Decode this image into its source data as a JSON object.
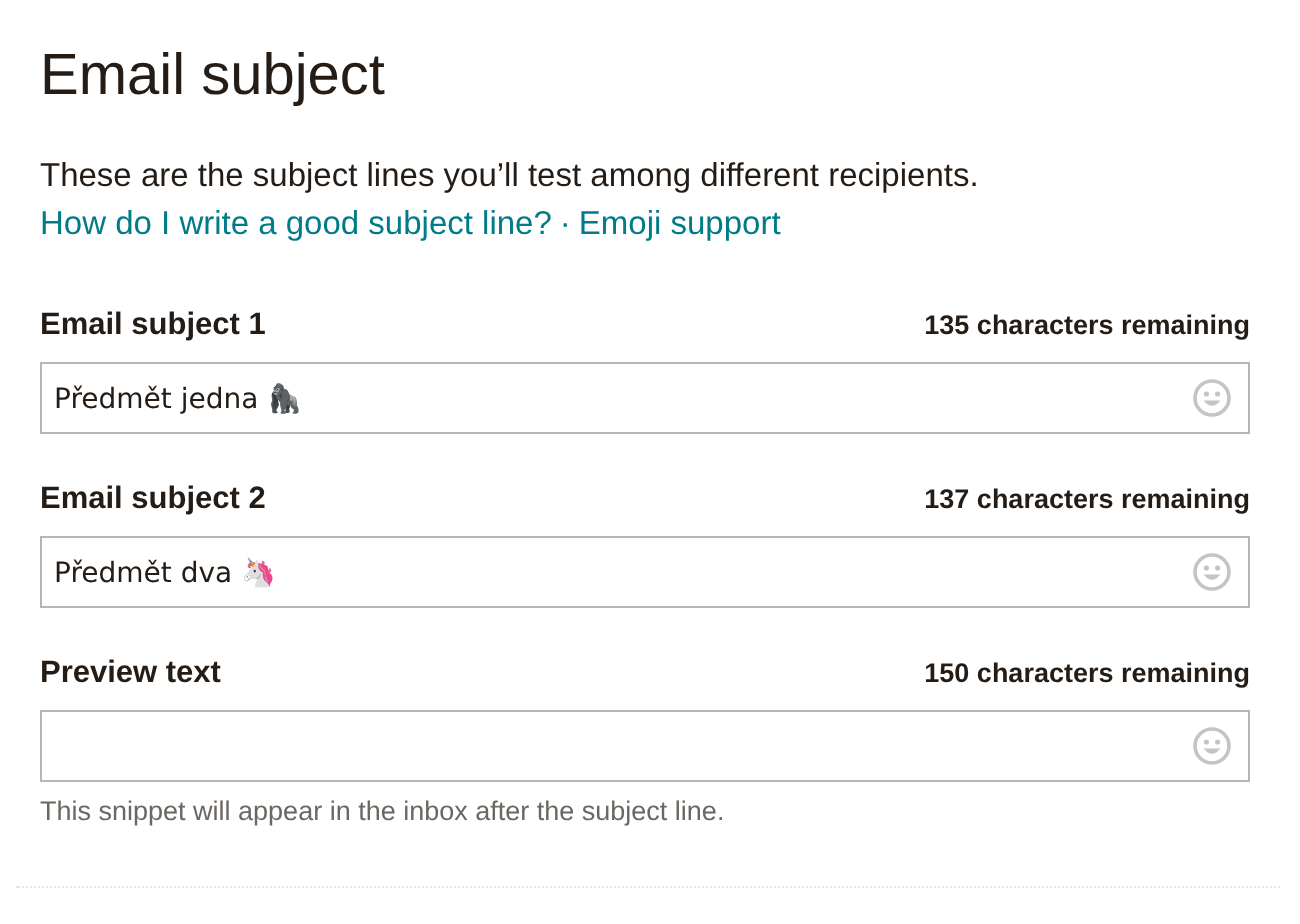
{
  "title": "Email subject",
  "description": "These are the subject lines you’ll test among different recipients.",
  "links": [
    {
      "label": "How do I write a good subject line?"
    },
    {
      "label": "Emoji support"
    }
  ],
  "link_separator": "·",
  "fields": [
    {
      "label": "Email subject 1",
      "remaining": "135 characters remaining",
      "value": "Předmět jedna 🦍"
    },
    {
      "label": "Email subject 2",
      "remaining": "137 characters remaining",
      "value": "Předmět dva 🦄"
    },
    {
      "label": "Preview text",
      "remaining": "150 characters remaining",
      "hint": "This snippet will appear in the inbox after the subject line."
    }
  ]
}
